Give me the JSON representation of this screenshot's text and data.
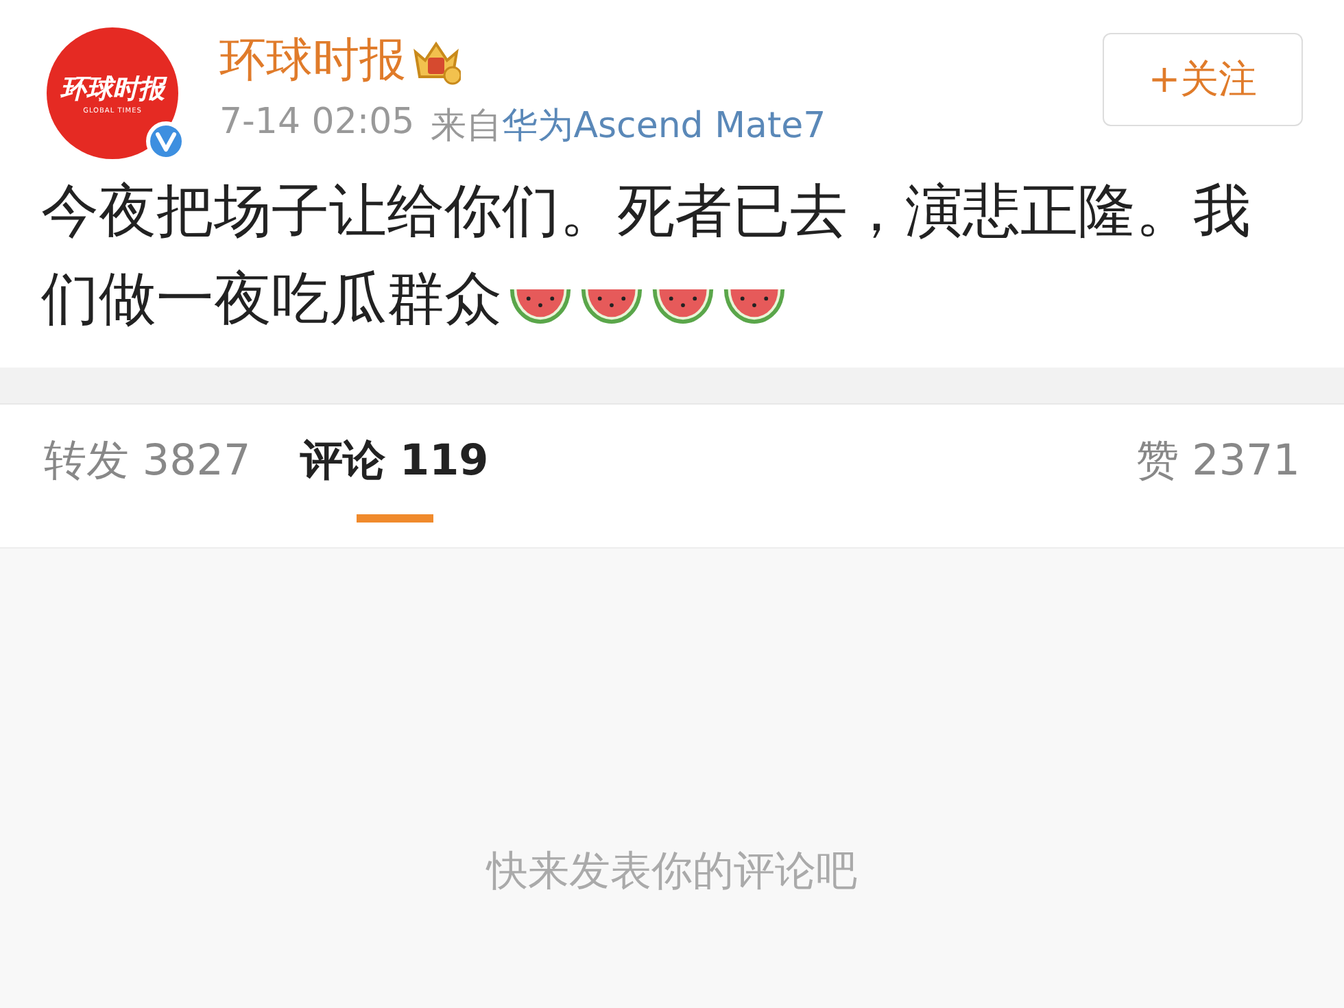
{
  "post": {
    "avatar_logo": {
      "chinese": "环球时报",
      "english": "GLOBAL TIMES"
    },
    "verified": true,
    "author": "环球时报",
    "member_badge": true,
    "time": "7-14 02:05",
    "source_prefix": "来自",
    "source": "华为Ascend Mate7",
    "follow_button": "+关注",
    "text_lines": [
      "今夜把场子让给你们。死者已去，演悲正隆。我",
      "们做一夜吃瓜群众"
    ],
    "emojis": [
      {
        "kind": "watermelon"
      },
      {
        "kind": "watermelon"
      },
      {
        "kind": "watermelon"
      },
      {
        "kind": "watermelon"
      }
    ]
  },
  "tabs": [
    {
      "label": "转发 3827",
      "selected": false
    },
    {
      "label": "评论 119",
      "selected": true
    },
    {
      "label": "赞 2371",
      "selected": false
    }
  ],
  "empty_state": "快来发表你的评论吧"
}
